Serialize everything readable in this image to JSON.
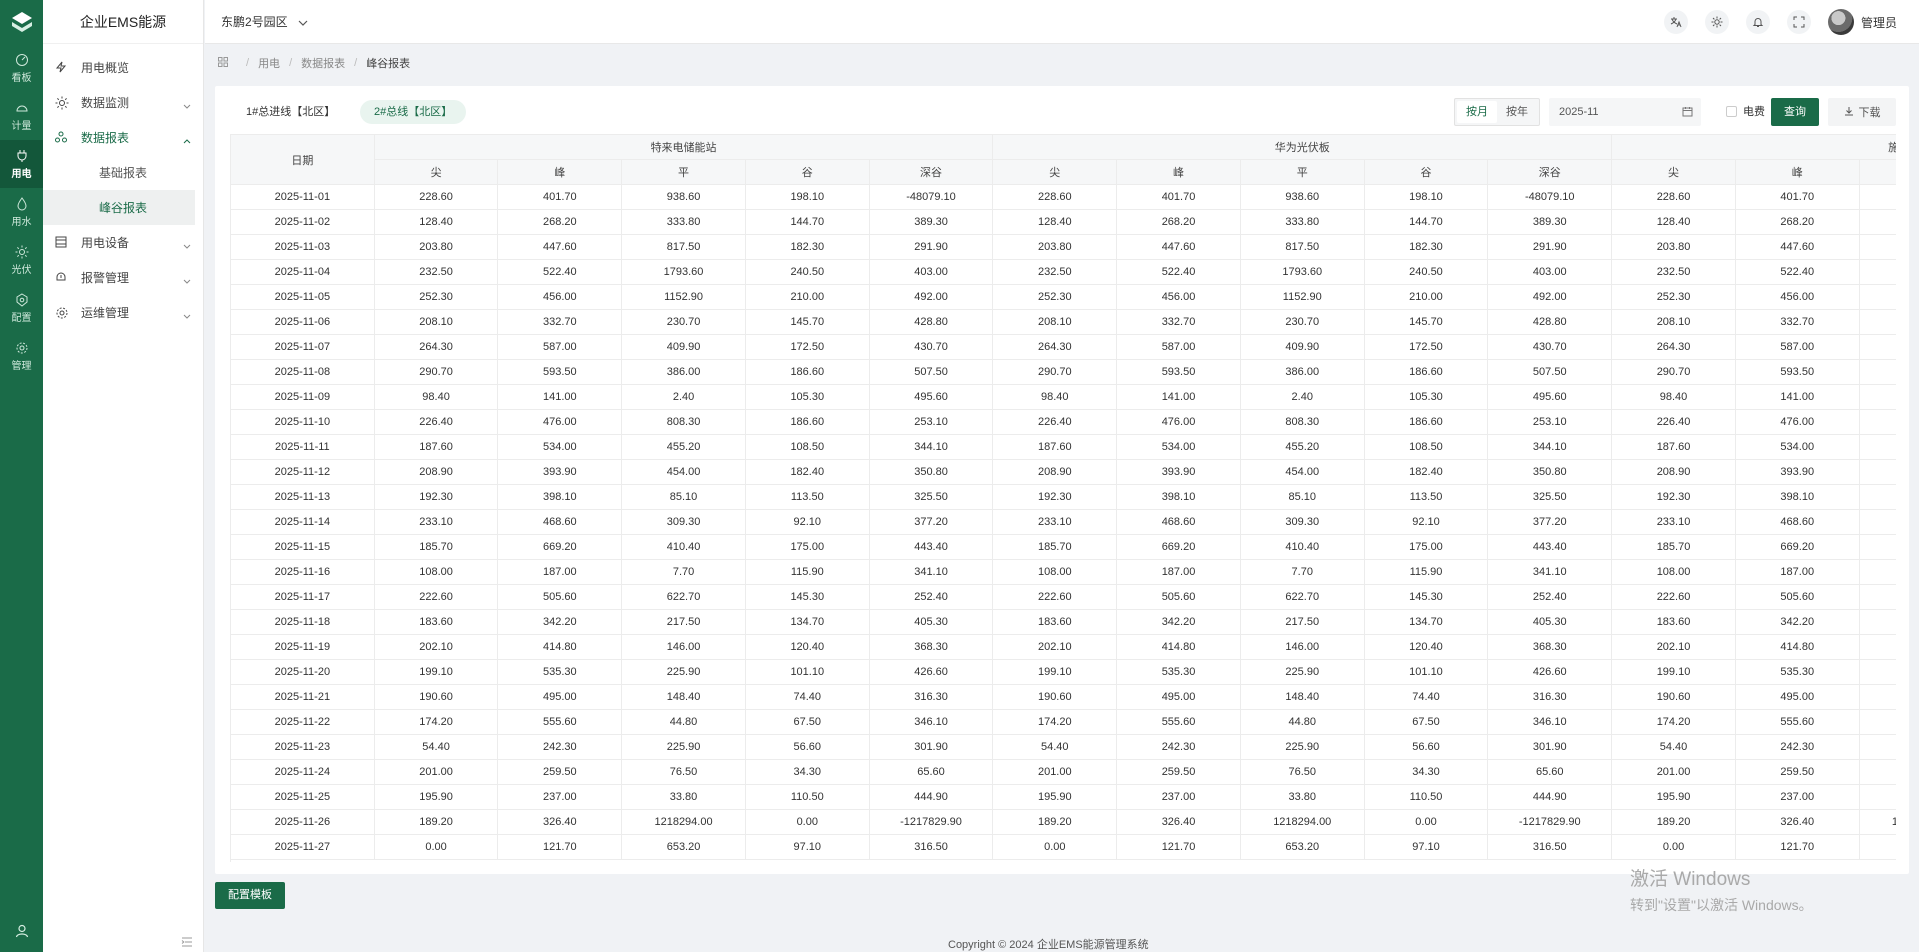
{
  "app": {
    "title": "企业EMS能源"
  },
  "rail": [
    {
      "label": "看板",
      "icon": "dashboard-icon",
      "active": false
    },
    {
      "label": "计量",
      "icon": "meter-icon",
      "active": false
    },
    {
      "label": "用电",
      "icon": "plug-icon",
      "active": true
    },
    {
      "label": "用水",
      "icon": "water-drop-icon",
      "active": false
    },
    {
      "label": "光伏",
      "icon": "sun-icon",
      "active": false
    },
    {
      "label": "配置",
      "icon": "config-icon",
      "active": false
    },
    {
      "label": "管理",
      "icon": "gear-icon",
      "active": false
    }
  ],
  "menu": {
    "items": [
      {
        "label": "用电概览",
        "icon": "bolt-icon",
        "expandable": false
      },
      {
        "label": "数据监测",
        "icon": "sun-icon",
        "expandable": true
      },
      {
        "label": "数据报表",
        "icon": "report-icon",
        "expandable": true,
        "open": true,
        "children": [
          {
            "label": "基础报表",
            "active": false
          },
          {
            "label": "峰谷报表",
            "active": true
          }
        ]
      },
      {
        "label": "用电设备",
        "icon": "device-icon",
        "expandable": true
      },
      {
        "label": "报警管理",
        "icon": "alarm-icon",
        "expandable": true
      },
      {
        "label": "运维管理",
        "icon": "gear-icon",
        "expandable": true
      }
    ]
  },
  "header": {
    "campus": "东鹏2号园区",
    "user": "管理员"
  },
  "breadcrumb": {
    "items": [
      "用电",
      "数据报表",
      "峰谷报表"
    ]
  },
  "toolbar": {
    "line_tabs": [
      "1#总进线【北区】",
      "2#总线【北区】"
    ],
    "active_line": 1,
    "mode_month": "按月",
    "mode_year": "按年",
    "date": "2025-11",
    "fee_label": "电费",
    "query": "查询",
    "download": "下载"
  },
  "table": {
    "date_header": "日期",
    "groups": [
      "特来电储能站",
      "华为光伏板",
      "施耐德变电房"
    ],
    "sub_headers": [
      "尖",
      "峰",
      "平",
      "谷",
      "深谷"
    ],
    "visible_last_group_cols": 4,
    "rows": [
      [
        "2025-11-01",
        "228.60",
        "401.70",
        "938.60",
        "198.10",
        "-48079.10"
      ],
      [
        "2025-11-02",
        "128.40",
        "268.20",
        "333.80",
        "144.70",
        "389.30"
      ],
      [
        "2025-11-03",
        "203.80",
        "447.60",
        "817.50",
        "182.30",
        "291.90"
      ],
      [
        "2025-11-04",
        "232.50",
        "522.40",
        "1793.60",
        "240.50",
        "403.00"
      ],
      [
        "2025-11-05",
        "252.30",
        "456.00",
        "1152.90",
        "210.00",
        "492.00"
      ],
      [
        "2025-11-06",
        "208.10",
        "332.70",
        "230.70",
        "145.70",
        "428.80"
      ],
      [
        "2025-11-07",
        "264.30",
        "587.00",
        "409.90",
        "172.50",
        "430.70"
      ],
      [
        "2025-11-08",
        "290.70",
        "593.50",
        "386.00",
        "186.60",
        "507.50"
      ],
      [
        "2025-11-09",
        "98.40",
        "141.00",
        "2.40",
        "105.30",
        "495.60"
      ],
      [
        "2025-11-10",
        "226.40",
        "476.00",
        "808.30",
        "186.60",
        "253.10"
      ],
      [
        "2025-11-11",
        "187.60",
        "534.00",
        "455.20",
        "108.50",
        "344.10"
      ],
      [
        "2025-11-12",
        "208.90",
        "393.90",
        "454.00",
        "182.40",
        "350.80"
      ],
      [
        "2025-11-13",
        "192.30",
        "398.10",
        "85.10",
        "113.50",
        "325.50"
      ],
      [
        "2025-11-14",
        "233.10",
        "468.60",
        "309.30",
        "92.10",
        "377.20"
      ],
      [
        "2025-11-15",
        "185.70",
        "669.20",
        "410.40",
        "175.00",
        "443.40"
      ],
      [
        "2025-11-16",
        "108.00",
        "187.00",
        "7.70",
        "115.90",
        "341.10"
      ],
      [
        "2025-11-17",
        "222.60",
        "505.60",
        "622.70",
        "145.30",
        "252.40"
      ],
      [
        "2025-11-18",
        "183.60",
        "342.20",
        "217.50",
        "134.70",
        "405.30"
      ],
      [
        "2025-11-19",
        "202.10",
        "414.80",
        "146.00",
        "120.40",
        "368.30"
      ],
      [
        "2025-11-20",
        "199.10",
        "535.30",
        "225.90",
        "101.10",
        "426.60"
      ],
      [
        "2025-11-21",
        "190.60",
        "495.00",
        "148.40",
        "74.40",
        "316.30"
      ],
      [
        "2025-11-22",
        "174.20",
        "555.60",
        "44.80",
        "67.50",
        "346.10"
      ],
      [
        "2025-11-23",
        "54.40",
        "242.30",
        "225.90",
        "56.60",
        "301.90"
      ],
      [
        "2025-11-24",
        "201.00",
        "259.50",
        "76.50",
        "34.30",
        "65.60"
      ],
      [
        "2025-11-25",
        "195.90",
        "237.00",
        "33.80",
        "110.50",
        "444.90"
      ],
      [
        "2025-11-26",
        "189.20",
        "326.40",
        "1218294.00",
        "0.00",
        "-1217829.90"
      ],
      [
        "2025-11-27",
        "0.00",
        "121.70",
        "653.20",
        "97.10",
        "316.50"
      ]
    ]
  },
  "config_template": "配置模板",
  "watermark": {
    "line1": "激活 Windows",
    "line2": "转到\"设置\"以激活 Windows。"
  },
  "copyright": "Copyright © 2024 企业EMS能源管理系统",
  "colors": {
    "primary": "#1a6b48",
    "rail": "#1a6b48"
  }
}
